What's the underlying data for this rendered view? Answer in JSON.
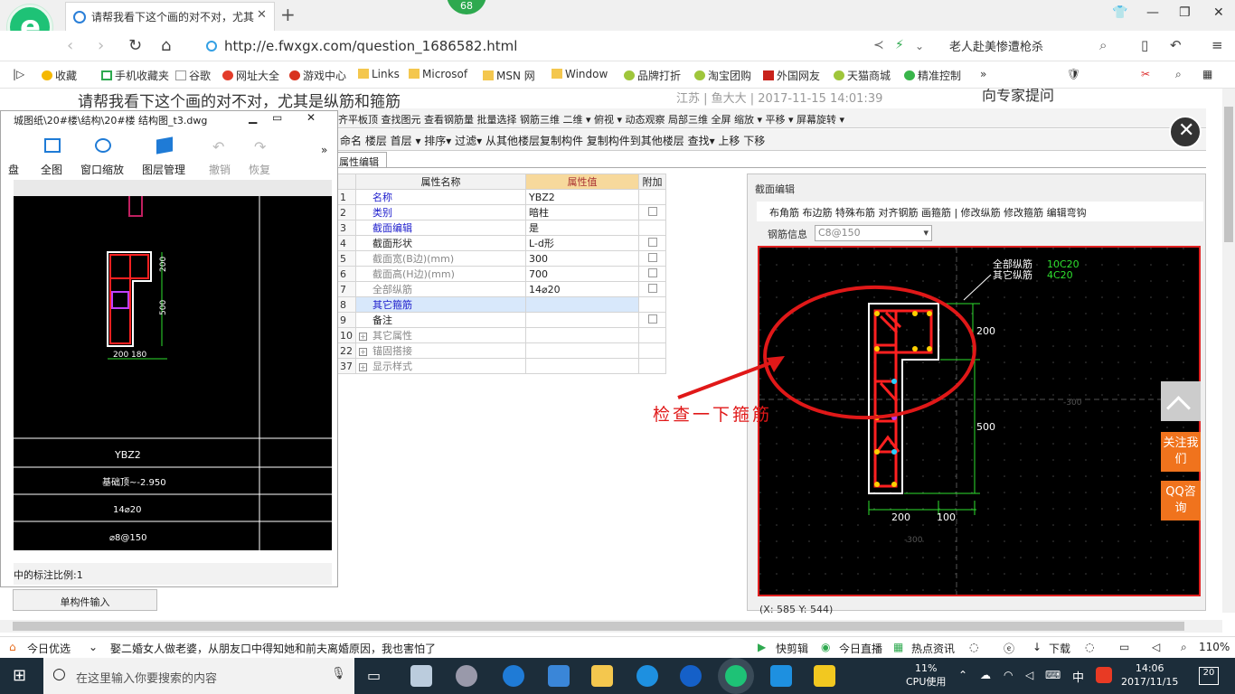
{
  "browser": {
    "tab_title": "请帮我看下这个画的对不对，尤其",
    "badge": "68",
    "url": "http://e.fwxgx.com/question_1686582.html",
    "search_text": "老人赴美惨遭枪杀"
  },
  "bookmarks": [
    {
      "label": "收藏",
      "color": "#f5b800"
    },
    {
      "label": "手机收藏夹",
      "color": "#2ea94f"
    },
    {
      "label": "谷歌",
      "color": "#777777"
    },
    {
      "label": "网址大全",
      "color": "#e33c2a"
    },
    {
      "label": "游戏中心",
      "color": "#d8321e"
    },
    {
      "label": "Links",
      "color": "#f4c74e"
    },
    {
      "label": "Microsof",
      "color": "#f4c74e"
    },
    {
      "label": "MSN 网",
      "color": "#f4c74e"
    },
    {
      "label": "Window",
      "color": "#f4c74e"
    },
    {
      "label": "品牌打折",
      "color": "#9fc63b"
    },
    {
      "label": "淘宝团购",
      "color": "#9fc63b"
    },
    {
      "label": "外国网友",
      "color": "#c8221b"
    },
    {
      "label": "天猫商城",
      "color": "#9fc63b"
    },
    {
      "label": "精准控制",
      "color": "#39b54a"
    }
  ],
  "page": {
    "question": "请帮我看下这个画的对不对，尤其是纵筋和箍筋",
    "meta": "江苏 | 鱼大大 | 2017-11-15 14:01:39",
    "ask": "向专家提问"
  },
  "cad": {
    "toolbar1": "齐平板顶  查找图元  查看钢筋量  批量选择  钢筋三维  二维 ▾  俯视 ▾  动态观察  局部三维  全屏  缩放 ▾  平移 ▾  屏幕旋转 ▾",
    "toolbar2": "命名  楼层  首层  ▾   排序▾   过滤▾   从其他楼层复制构件   复制构件到其他楼层   查找▾   上移   下移",
    "prop_tab": "属性编辑",
    "table_headers": {
      "name": "属性名称",
      "value": "属性值",
      "extra": "附加"
    },
    "rows": [
      {
        "no": "1",
        "name": "名称",
        "value": "YBZ2",
        "style": "blue",
        "check": false
      },
      {
        "no": "2",
        "name": "类别",
        "value": "暗柱",
        "style": "blue",
        "check": true
      },
      {
        "no": "3",
        "name": "截面编辑",
        "value": "是",
        "style": "blue",
        "check": false
      },
      {
        "no": "4",
        "name": "截面形状",
        "value": "L-d形",
        "style": "normal",
        "check": true
      },
      {
        "no": "5",
        "name": "截面宽(B边)(mm)",
        "value": "300",
        "style": "grey",
        "check": true
      },
      {
        "no": "6",
        "name": "截面高(H边)(mm)",
        "value": "700",
        "style": "grey",
        "check": true
      },
      {
        "no": "7",
        "name": "全部纵筋",
        "value": "14⌀20",
        "style": "grey",
        "check": true
      },
      {
        "no": "8",
        "name": "其它箍筋",
        "value": "",
        "style": "blue",
        "check": false,
        "selected": true
      },
      {
        "no": "9",
        "name": "备注",
        "value": "",
        "style": "normal",
        "check": true
      },
      {
        "no": "10",
        "name": "其它属性",
        "value": "",
        "style": "grey",
        "check": false,
        "expand": true
      },
      {
        "no": "22",
        "name": "锚固搭接",
        "value": "",
        "style": "grey",
        "check": false,
        "expand": true
      },
      {
        "no": "37",
        "name": "显示样式",
        "value": "",
        "style": "grey",
        "check": false,
        "expand": true
      }
    ]
  },
  "section": {
    "title": "截面编辑",
    "tools": "布角筋  布边筋  特殊布筋  对齐钢筋  画箍筋  |  修改纵筋  修改箍筋  编辑弯钩",
    "rebar_label": "钢筋信息",
    "rebar_value": "C8@150",
    "legend_all": "全部纵筋",
    "legend_all_value": "10C20",
    "legend_other": "其它纵筋",
    "legend_other_value": "4C20",
    "dim_200_right": "200",
    "dim_500": "500",
    "dim_200_bottom": "200",
    "dim_100": "100",
    "dim_faint_300": "-300",
    "dim_faint_300b": "-300",
    "coords": "(X: 585 Y: 544)",
    "annotation": "检查一下箍筋"
  },
  "dwg": {
    "title": "城图纸\\20#楼\\结构\\20#楼 结构图_t3.dwg",
    "tools": [
      "盘",
      "全图",
      "窗口缩放",
      "图层管理",
      "撤销",
      "恢复"
    ],
    "dim_200": "200",
    "dim_500": "500",
    "dim_bottom": "200  180",
    "cell_name": "YBZ2",
    "cell_height": "基础顶~-2.950",
    "cell_rebar": "14⌀20",
    "cell_stirrup": "⌀8@150",
    "status": "中的标注比例:1",
    "sub_button": "单构件输入"
  },
  "side": {
    "follow": "关注我们",
    "qq": "QQ咨询"
  },
  "news": {
    "left": "今日优选",
    "headline": "娶二婚女人做老婆，从朋友口中得知她和前夫离婚原因，我也害怕了",
    "kuaijian": "快剪辑",
    "live": "今日直播",
    "hot": "热点资讯",
    "download": "下载",
    "zoom": "110%"
  },
  "taskbar": {
    "search_placeholder": "在这里输入你要搜索的内容",
    "cpu": "11%",
    "cpu_label": "CPU使用",
    "ime": "中",
    "time": "14:06",
    "date": "2017/11/15",
    "notif": "20"
  }
}
